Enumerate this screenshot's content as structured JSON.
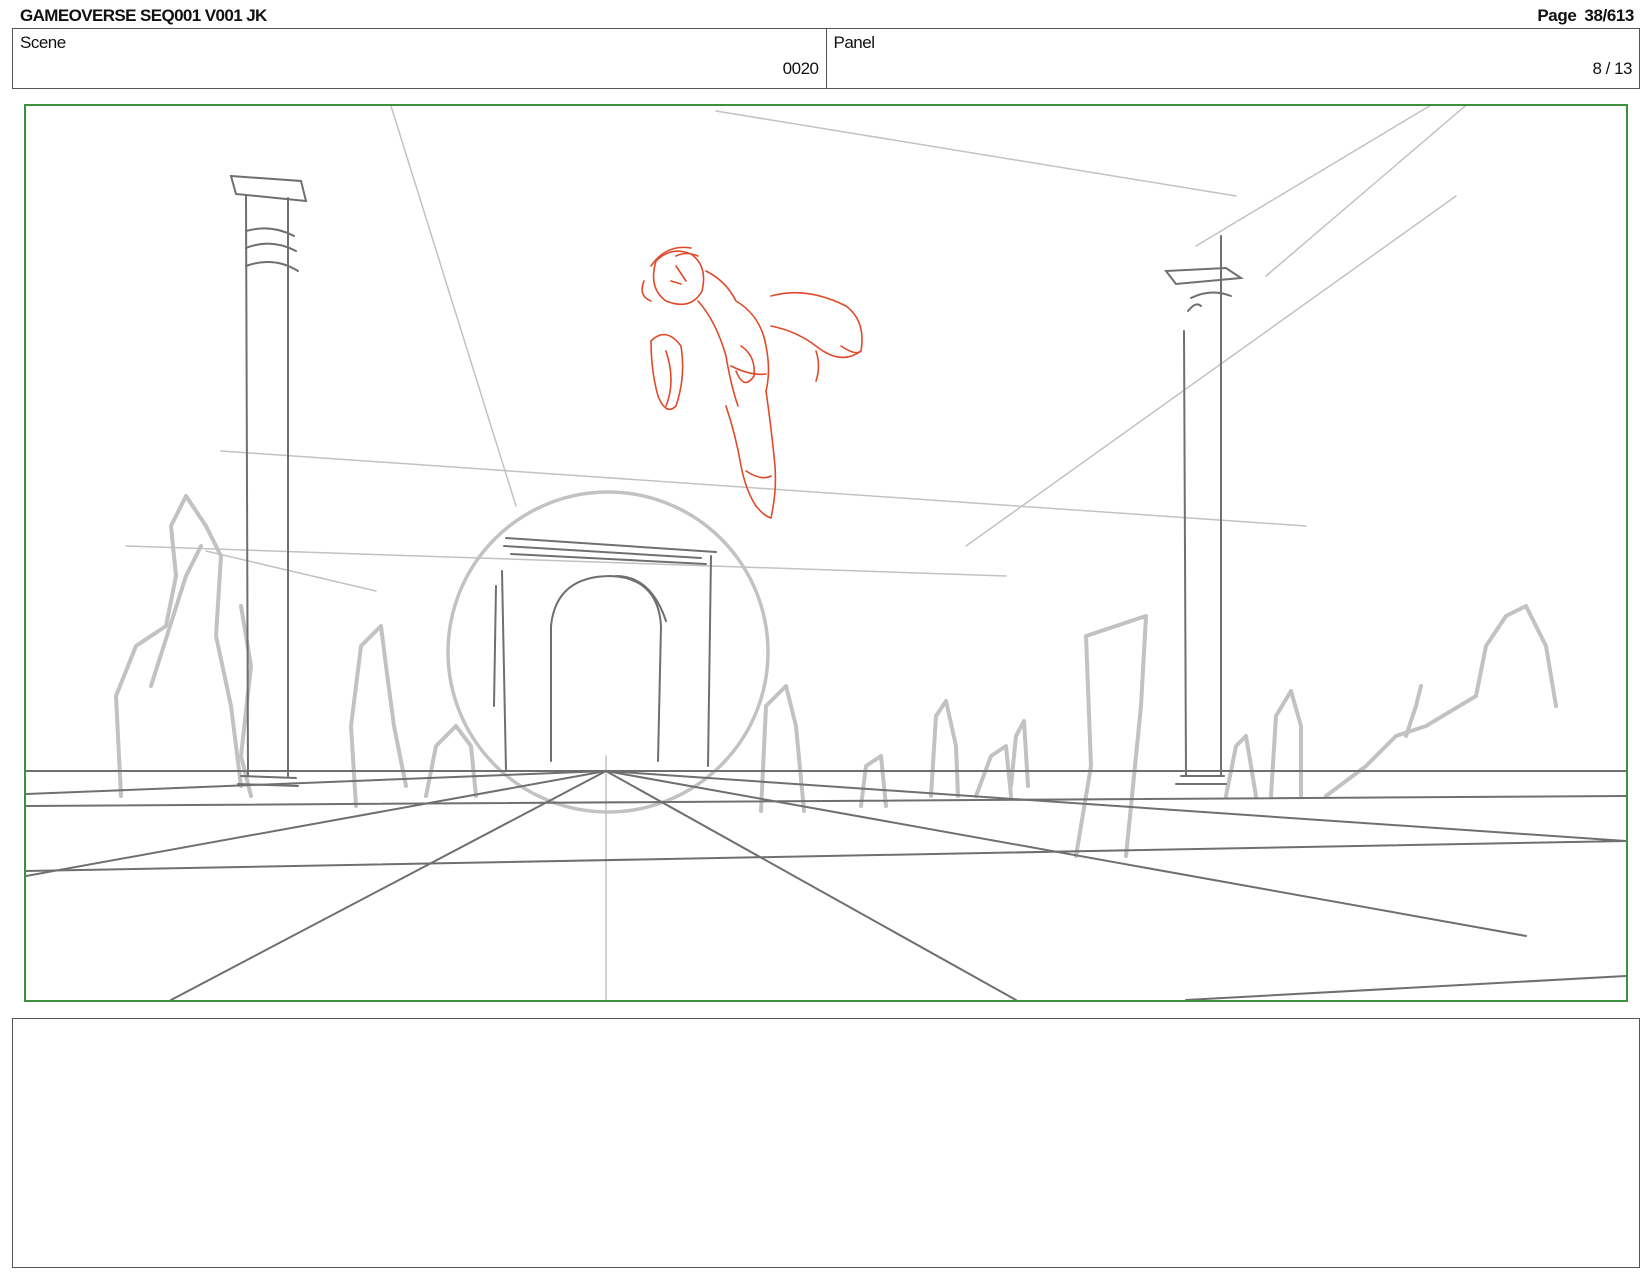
{
  "header": {
    "title": "GAMEOVERSE SEQ001 V001 JK",
    "page_label": "Page",
    "page_number": "38/613"
  },
  "scene": {
    "label": "Scene",
    "value": "0020"
  },
  "panel": {
    "label": "Panel",
    "value": "8 / 13"
  },
  "sketch": {
    "line_color": "#6f6f6f",
    "light_line_color": "#c2c2c2",
    "character_color": "#e04a2a",
    "frame_border_color": "#3e8f3e"
  },
  "notes": {
    "text": ""
  }
}
